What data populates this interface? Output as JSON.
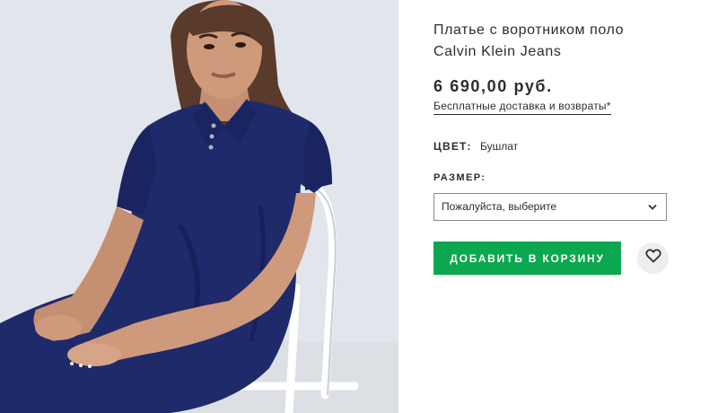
{
  "product": {
    "title_line1": "Платье с воротником поло",
    "title_line2": "Calvin Klein Jeans",
    "price": "6 690,00 руб.",
    "delivery_link": "Бесплатные доставка и возвраты*",
    "color_label": "ЦВЕТ:",
    "color_value": "Бушлат",
    "size_label": "РАЗМЕР:",
    "size_select": {
      "selected": "Пожалуйста, выберите"
    },
    "add_to_bag_label": "ДОБАВИТЬ В КОРЗИНУ"
  },
  "icons": {
    "dropdown": "chevron-down-icon",
    "wishlist": "heart-icon"
  },
  "colors": {
    "accent_green": "#0ba84f",
    "dress_navy": "#1f2a6b",
    "text": "#2d2d2d",
    "wish_bg": "#eeeeee"
  }
}
